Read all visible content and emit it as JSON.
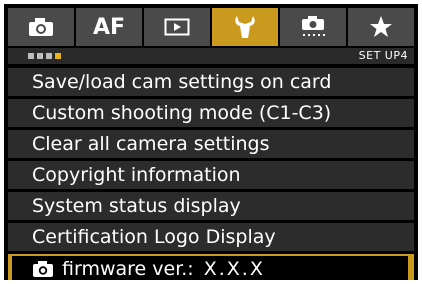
{
  "tabs": [
    {
      "id": "shooting",
      "icon": "camera-icon",
      "label": ""
    },
    {
      "id": "af",
      "icon": "",
      "label": "AF"
    },
    {
      "id": "playback",
      "icon": "playback-icon",
      "label": ""
    },
    {
      "id": "setup",
      "icon": "wrench-icon",
      "label": "",
      "active": true
    },
    {
      "id": "custom",
      "icon": "custom-functions-icon",
      "label": ""
    },
    {
      "id": "mymenu",
      "icon": "star-icon",
      "label": ""
    }
  ],
  "subbar": {
    "page_count": 4,
    "current_page": 4,
    "label": "SET UP4"
  },
  "menu": {
    "items": [
      {
        "label": "Save/load cam settings on card"
      },
      {
        "label": "Custom shooting mode (C1-C3)"
      },
      {
        "label": "Clear all camera settings"
      },
      {
        "label": "Copyright information"
      },
      {
        "label": "System status display"
      },
      {
        "label": "Certification Logo Display"
      }
    ],
    "selected": {
      "icon": "camera-icon",
      "label": "firmware ver.:",
      "value": "X.X.X"
    }
  },
  "colors": {
    "accent": "#c99a1e",
    "tab_bg": "#4a4a4a",
    "item_bg": "#2c2c2c",
    "background": "#000000"
  }
}
